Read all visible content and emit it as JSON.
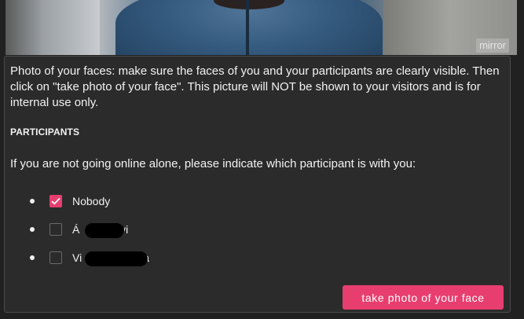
{
  "camera": {
    "mirror_label": "mirror"
  },
  "intro_text": "Photo of your faces: make sure the faces of you and your participants are clearly visible. Then click on \"take photo of your face\". This picture will NOT be shown to your visitors and is for internal use only.",
  "participants": {
    "title": "PARTICIPANTS",
    "question": "If you are not going online alone, please indicate which participant is with you:",
    "options": [
      {
        "label": "Nobody",
        "checked": true
      },
      {
        "label_start": "Á",
        "label_end": "nyi",
        "checked": false,
        "redacted": true
      },
      {
        "label_start": "Vi",
        "label_end": "olla",
        "checked": false,
        "redacted": true
      }
    ]
  },
  "actions": {
    "take_photo_label": "take photo of your face"
  },
  "colors": {
    "accent": "#e83e6f",
    "panel_bg": "#2b2b2b",
    "page_bg": "#212121"
  },
  "icons": {
    "checkmark": "checkmark-icon",
    "bullet": "bullet-dot"
  }
}
